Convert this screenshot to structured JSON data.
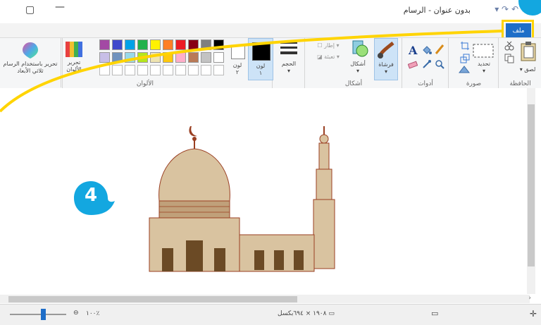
{
  "window": {
    "title": "بدون عنوان - الرسام",
    "minimize_glyph": "—",
    "restore_glyph": "▢"
  },
  "tabs": {
    "file": "ملف"
  },
  "ribbon": {
    "clipboard": {
      "label": "الحافظة",
      "paste": "لصق"
    },
    "image": {
      "label": "صورة",
      "select": "تحديد"
    },
    "tools": {
      "label": "أدوات"
    },
    "shapes_group": {
      "label": "أشكال",
      "brushes": "فرشاة",
      "shapes": "أشكال",
      "outline": "إطار",
      "fill": "تعبئة"
    },
    "size": {
      "label": "الحجم"
    },
    "color1": {
      "label": "لون",
      "index": "١"
    },
    "color2": {
      "label": "لون",
      "index": "٢"
    },
    "colors": {
      "label": "الألوان",
      "palette_row1": [
        "#000000",
        "#7f7f7f",
        "#880015",
        "#ed1c24",
        "#ff7f27",
        "#fff200",
        "#22b14c",
        "#00a2e8",
        "#3f48cc",
        "#a349a4"
      ],
      "palette_row2": [
        "#ffffff",
        "#c3c3c3",
        "#b97a57",
        "#ffaec9",
        "#ffc90e",
        "#efe4b0",
        "#b5e61d",
        "#99d9ea",
        "#7092be",
        "#c8bfe7"
      ]
    },
    "edit_colors": "تحرير الألوان",
    "paint3d": "تحرير باستخدام الرسام ثلاثي الأبعاد"
  },
  "status": {
    "dimensions": "١٩٠٨ × ٦٩٤بكسل",
    "zoom": "١٠٠٪"
  },
  "annotation": {
    "step": "4"
  },
  "colors": {
    "file_tab": "#1e6ec8",
    "highlight": "#ffd400",
    "badge": "#13a7e0",
    "mosque_fill": "#d9c3a0",
    "mosque_outline": "#9a3f22",
    "mosque_dark": "#6b4a25"
  }
}
